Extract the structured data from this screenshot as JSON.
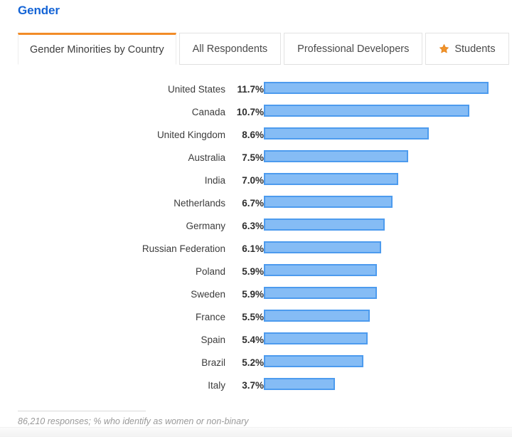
{
  "header": {
    "title": "Gender",
    "title_color": "#1464d6"
  },
  "tabs": {
    "active_index": 0,
    "accent_color": "#f28c28",
    "items": [
      {
        "label": "Gender Minorities by Country",
        "active": true,
        "icon": null
      },
      {
        "label": "All Respondents",
        "active": false,
        "icon": null
      },
      {
        "label": "Professional Developers",
        "active": false,
        "icon": null
      },
      {
        "label": "Students",
        "active": false,
        "icon": "star-icon"
      }
    ]
  },
  "footer": {
    "note": "86,210 responses; % who identify as women or non-binary"
  },
  "chart_data": {
    "type": "bar",
    "orientation": "horizontal",
    "title": "Gender Minorities by Country",
    "xlabel": "",
    "ylabel": "",
    "xlim": [
      0,
      11.7
    ],
    "grid": false,
    "legend": false,
    "value_suffix": "%",
    "bar_fill_color": "#85bcf5",
    "bar_border_color": "#4d9bee",
    "categories": [
      "United States",
      "Canada",
      "United Kingdom",
      "Australia",
      "India",
      "Netherlands",
      "Germany",
      "Russian Federation",
      "Poland",
      "Sweden",
      "France",
      "Spain",
      "Brazil",
      "Italy"
    ],
    "values": [
      11.7,
      10.7,
      8.6,
      7.5,
      7.0,
      6.7,
      6.3,
      6.1,
      5.9,
      5.9,
      5.5,
      5.4,
      5.2,
      3.7
    ],
    "value_labels": [
      "11.7%",
      "10.7%",
      "8.6%",
      "7.5%",
      "7.0%",
      "6.7%",
      "6.3%",
      "6.1%",
      "5.9%",
      "5.9%",
      "5.5%",
      "5.4%",
      "5.2%",
      "3.7%"
    ]
  }
}
